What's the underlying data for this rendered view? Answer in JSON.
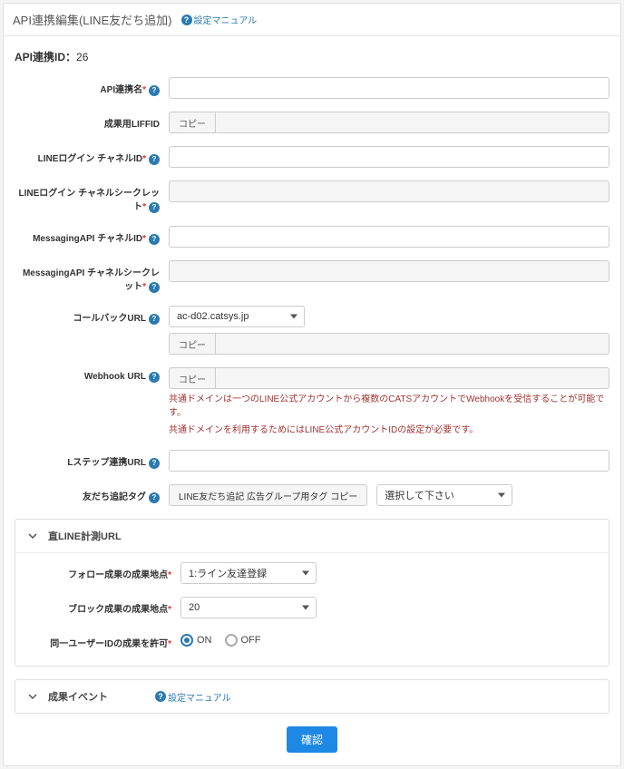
{
  "header": {
    "title": "API連携編集(LINE友だち追加)",
    "manual_link_label": "設定マニュアル"
  },
  "section": {
    "id_label": "API連携ID：",
    "id_value": "26"
  },
  "fields": {
    "api_name": {
      "label": "API連携名",
      "value": ""
    },
    "liff_id": {
      "label": "成果用LIFFID",
      "copy": "コピー",
      "value": ""
    },
    "login_channel": {
      "label": "LINEログイン チャネルID",
      "value": ""
    },
    "login_secret": {
      "label": "LINEログイン チャネルシークレット",
      "value": ""
    },
    "msg_channel": {
      "label": "MessagingAPI チャネルID",
      "value": ""
    },
    "msg_secret": {
      "label": "MessagingAPI チャネルシークレット",
      "value": ""
    },
    "callback": {
      "label": "コールバックURL",
      "domain_selected": "ac-d02.catsys.jp",
      "copy": "コピー"
    },
    "webhook": {
      "label": "Webhook URL",
      "copy": "コピー",
      "note_line1": "共通ドメインは一つのLINE公式アカウントから複数のCATSアカウントでWebhookを受信することが可能です。",
      "note_line2": "共通ドメインを利用するためにはLINE公式アカウントIDの設定が必要です。"
    },
    "lstep": {
      "label": "Lステップ連携URL",
      "value": ""
    },
    "tag": {
      "label": "友だち追記タグ",
      "text": "LINE友だち追記 広告グループ用タグ コピー",
      "select_placeholder": "選択して下さい"
    }
  },
  "accordion_url": {
    "title": "直LINE計測URL",
    "follow_conv": {
      "label": "フォロー成果の成果地点",
      "selected": "1:ライン友達登録"
    },
    "block_conv": {
      "label": "ブロック成果の成果地点",
      "selected": "20"
    },
    "allow_same": {
      "label": "同一ユーザーIDの成果を許可",
      "on": "ON",
      "off": "OFF",
      "value": "on"
    }
  },
  "accordion_event": {
    "title": "成果イベント",
    "manual_link_label": "設定マニュアル"
  },
  "submit_label": "確認"
}
